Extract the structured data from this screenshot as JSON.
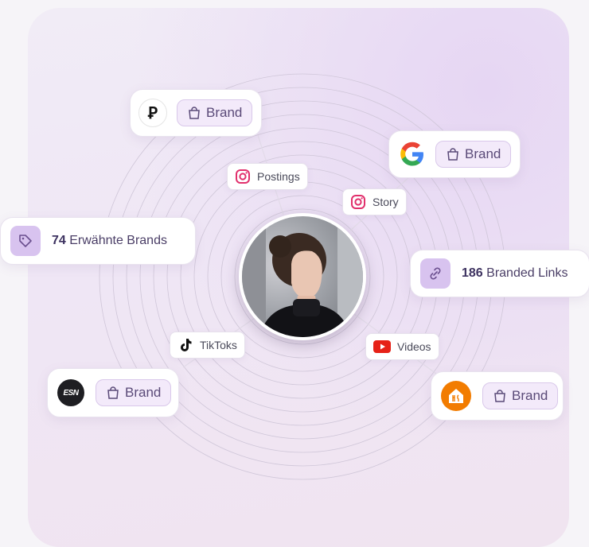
{
  "brand_chip_label": "Brand",
  "stats": {
    "brands_count": "74",
    "brands_label": " Erwähnte Brands",
    "links_count": "186",
    "links_label": " Branded Links"
  },
  "tags": {
    "postings": "Postings",
    "story": "Story",
    "tiktoks": "TikToks",
    "videos": "Videos"
  },
  "logos": {
    "top_left": "Ꝑ",
    "esn": "ESN",
    "google": "G"
  },
  "icons": [
    "shopping-bag-icon",
    "instagram-icon",
    "tiktok-icon",
    "youtube-icon",
    "tag-icon",
    "link-icon"
  ],
  "colors": {
    "accent": "#d8c3ef",
    "chip_bg": "#f3eafa",
    "instagram": "#e1306c",
    "youtube": "#e62117",
    "lieferando": "#f27c00"
  }
}
